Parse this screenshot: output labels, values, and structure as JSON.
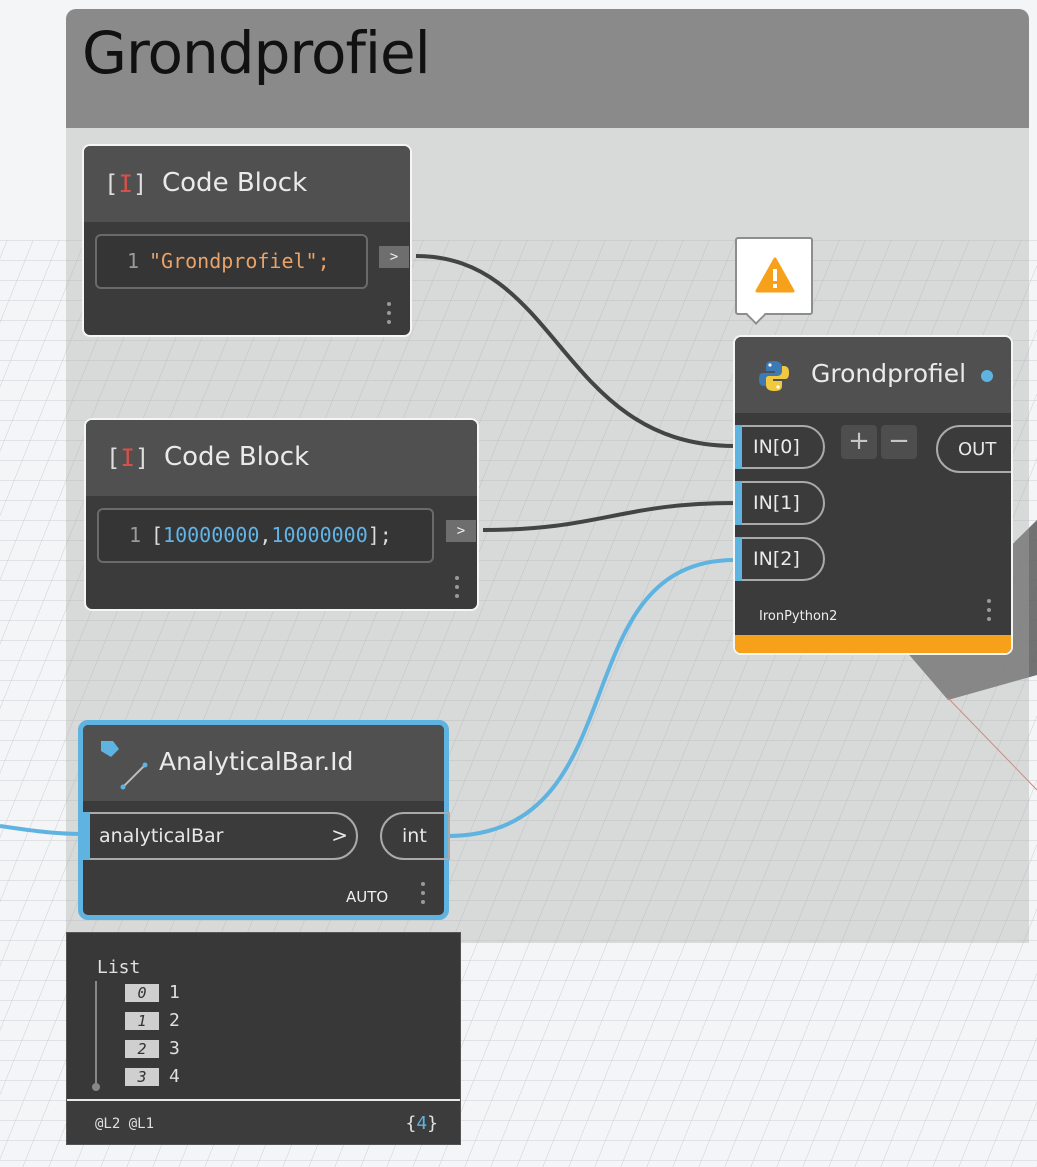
{
  "group": {
    "title": "Grondprofiel"
  },
  "code_block_1": {
    "title": "Code Block",
    "line_no": "1",
    "code": "\"Grondprofiel\";",
    "out": ">"
  },
  "code_block_2": {
    "title": "Code Block",
    "line_no": "1",
    "code_open": "[",
    "num1": "10000000",
    "comma": ",",
    "num2": "10000000",
    "code_close": "];",
    "out": ">"
  },
  "python_node": {
    "title": "Grondprofiel",
    "inputs": [
      "IN[0]",
      "IN[1]",
      "IN[2]"
    ],
    "add": "+",
    "remove": "−",
    "output": "OUT",
    "engine": "IronPython2",
    "warning_color": "#f7a11a",
    "status_color": "#5fb3e0"
  },
  "analytical_node": {
    "title": "AnalyticalBar.Id",
    "input": "analyticalBar",
    "input_arrow": ">",
    "output": "int",
    "lacing": "AUTO",
    "highlight_color": "#5fb3e0"
  },
  "watch": {
    "header": "List",
    "items": [
      {
        "index": "0",
        "value": "1"
      },
      {
        "index": "1",
        "value": "2"
      },
      {
        "index": "2",
        "value": "3"
      },
      {
        "index": "3",
        "value": "4"
      }
    ],
    "levels": "@L2 @L1",
    "count_open": "{",
    "count": "4",
    "count_close": "}"
  }
}
